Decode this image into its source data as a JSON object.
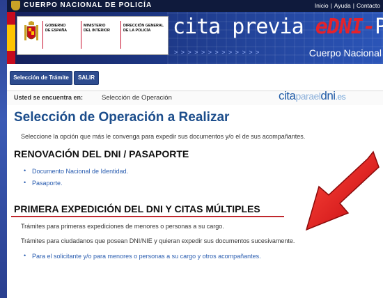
{
  "header": {
    "police_title": "CUERPO NACIONAL DE POLICÍA",
    "links": [
      "Inicio",
      "Ayuda",
      "Contacto"
    ]
  },
  "banner": {
    "gov_col1": [
      "GOBIERNO",
      "DE ESPAÑA"
    ],
    "gov_col2": [
      "MINISTERIO",
      "DEL INTERIOR"
    ],
    "gov_col3": [
      "DIRECCIÓN GENERAL",
      "DE LA POLICÍA"
    ],
    "title_part1": "cita previa ",
    "title_part2": "eDNI-",
    "title_part3": "Pasa",
    "subtitle": "Cuerpo Nacional"
  },
  "nav": {
    "select_label": "Selección de Trámite",
    "exit_label": "SALIR"
  },
  "breadcrumb": {
    "label": "Usted se encuentra en:",
    "current": "Selección de Operación",
    "brand_cita": "cita",
    "brand_para": "parael",
    "brand_dni": "dni",
    "brand_es": ".es"
  },
  "main": {
    "title": "Selección de Operación a Realizar",
    "intro": "Seleccione la opción que más le convenga para expedir sus documentos y/o el de sus acompañantes.",
    "renovacion": {
      "heading": "RENOVACIÓN DEL DNI / PASAPORTE",
      "items": [
        "Documento Nacional de Identidad.",
        "Pasaporte."
      ]
    },
    "primera": {
      "heading": "PRIMERA EXPEDICIÓN DEL DNI Y CITAS MÚLTIPLES",
      "para1": "Trámites para primeras expediciones de menores o personas a su cargo.",
      "para2": "Trámites para ciudadanos que posean DNI/NIE y quieran expedir sus documentos sucesivamente.",
      "items": [
        "Para el solicitante y/o para menores o personas a su cargo y otros acompañantes."
      ]
    }
  },
  "colors": {
    "accent": "#1d4e8c",
    "link": "#2a5db0",
    "arrow": "#e0161c",
    "underline": "#c0272d"
  }
}
